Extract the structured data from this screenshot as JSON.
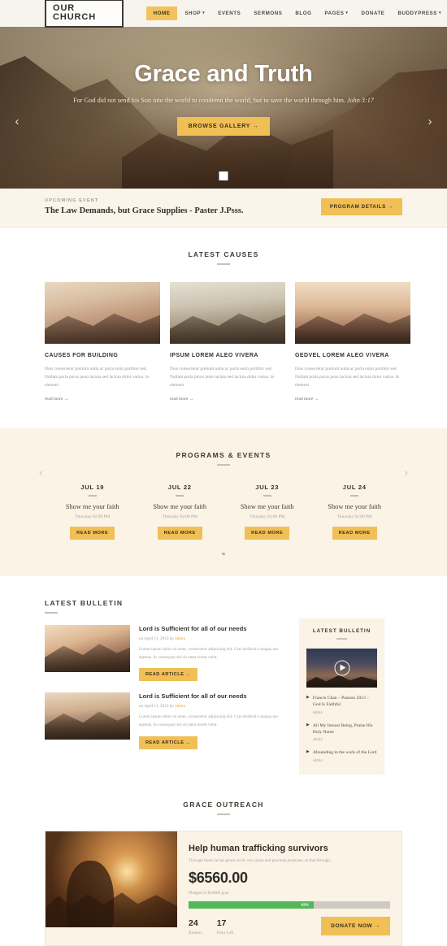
{
  "header": {
    "logo": "OUR CHURCH",
    "nav": [
      {
        "label": "HOME",
        "has_caret": false,
        "active": true
      },
      {
        "label": "SHOP",
        "has_caret": true,
        "active": false
      },
      {
        "label": "EVENTS",
        "has_caret": false,
        "active": false
      },
      {
        "label": "SERMONS",
        "has_caret": false,
        "active": false
      },
      {
        "label": "BLOG",
        "has_caret": false,
        "active": false
      },
      {
        "label": "PAGES",
        "has_caret": true,
        "active": false
      },
      {
        "label": "DONATE",
        "has_caret": false,
        "active": false
      },
      {
        "label": "BUDDYPRESS",
        "has_caret": true,
        "active": false
      }
    ]
  },
  "hero": {
    "title": "Grace and Truth",
    "subtitle": "For God did not send his Son into the world to condemn the world, but to save the world through him.",
    "reference": "John 3:17",
    "cta": "BROWSE GALLERY →",
    "prev_arrow": "‹",
    "next_arrow": "›"
  },
  "event_bar": {
    "label": "UPCOMING EVENT",
    "title": "The Law Demands, but Grace Supplies - Paster J.Psss.",
    "cta": "PROGRAM DETAILS →"
  },
  "causes": {
    "heading": "LATEST CAUSES",
    "items": [
      {
        "title": "CAUSES FOR BUILDING",
        "text": "Duis consectetur pretium nulla ac porta enim porttitor sed. Nullam porta purus justo lacinia sed lacinia dolor varius. In element",
        "link": "read more →"
      },
      {
        "title": "IPSUM LOREM ALEO VIVERA",
        "text": "Duis consectetur pretium nulla ac porta enim porttitor sed. Nullam porta purus justo lacinia sed lacinia dolor varius. In element",
        "link": "read more →"
      },
      {
        "title": "GEDVEL LOREM ALEO VIVERA",
        "text": "Duis consectetur pretium nulla ac porta enim porttitor sed. Nullam porta purus justo lacinia sed lacinia dolor varius. In element",
        "link": "read more →"
      }
    ]
  },
  "programs": {
    "heading": "PROGRAMS & EVENTS",
    "prev_arrow": "‹",
    "next_arrow": "›",
    "items": [
      {
        "date": "JUL 19",
        "name": "Show me your faith",
        "time": "Thursday 02:00 PM",
        "cta": "READ MORE"
      },
      {
        "date": "JUL 22",
        "name": "Show me your faith",
        "time": "Thursday 02:00 PM",
        "cta": "READ MORE"
      },
      {
        "date": "JUL 23",
        "name": "Show me your faith",
        "time": "Thursday 02:00 PM",
        "cta": "READ MORE"
      },
      {
        "date": "JUL 24",
        "name": "Show me your faith",
        "time": "Thursday 02:00 PM",
        "cta": "READ MORE"
      }
    ]
  },
  "bulletin": {
    "heading": "LATEST BULLETIN",
    "posts": [
      {
        "title": "Lord is Sufficient for all of our needs",
        "meta_prefix": "on April 11, 2013 by ",
        "author": "admin",
        "text": "Lorem ipsum dolor sit amet, consectetur adipiscing elit. Cras eleifend a magna nec egestas. In consequat nisl sit amet lorem velut.",
        "cta": "READ ARTICLE →"
      },
      {
        "title": "Lord is Sufficient for all of our needs",
        "meta_prefix": "on April 11, 2013 by ",
        "author": "admin",
        "text": "Lorem ipsum dolor sit amet, consectetur adipiscing elit. Cras eleifend a magna nec egestas. In consequat nisl sit amet lorem velut.",
        "cta": "READ ARTICLE →"
      }
    ]
  },
  "widget": {
    "title": "LATEST BULLETIN",
    "items": [
      {
        "link": "Francis Chan – Passion 2013 – God Is Faithful",
        "author": "admin"
      },
      {
        "link": "All My Inmost Being, Praise His Holy Name",
        "author": "admin"
      },
      {
        "link": "Abounding in the work of the Lord",
        "author": "admin"
      }
    ]
  },
  "outreach": {
    "heading": "GRACE OUTREACH",
    "title": "Help human trafficking survivors",
    "description": "Through these he has given us his very great and precious promises, so that through...",
    "amount": "$6560.00",
    "goal_text": "Pledged of $10000 goal",
    "progress_pct": "62%",
    "progress_value": 62,
    "backers_count": "24",
    "backers_label": "Backers",
    "days_count": "17",
    "days_label": "Days Left",
    "cta": "DONATE NOW →"
  },
  "colors": {
    "gold": "#f0bf56",
    "cream": "#faf3e6",
    "green": "#52b85a"
  }
}
